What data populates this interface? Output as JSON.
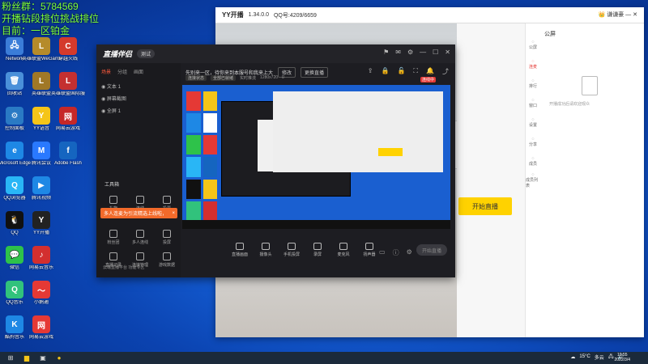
{
  "overlay": {
    "line1": "粉丝群：5784569",
    "line2": "开播钻段排位挑战排位",
    "line3": "目前：一区铂金",
    "right_tag": "5686"
  },
  "desktop_icons": [
    {
      "label": "Network",
      "color": "#3b7dd8",
      "glyph": "🖧"
    },
    {
      "label": "英雄联盟WeGame版",
      "color": "#b58b2a",
      "glyph": "L"
    },
    {
      "label": "穿越火线",
      "color": "#d43a2c",
      "glyph": "C"
    },
    {
      "label": "回收站",
      "color": "#4a90d9",
      "glyph": "🗑"
    },
    {
      "label": "英雄联盟",
      "color": "#a07826",
      "glyph": "L"
    },
    {
      "label": "英雄联盟国际服",
      "color": "#c43030",
      "glyph": "L"
    },
    {
      "label": "控制面板",
      "color": "#2a7ac4",
      "glyph": "⚙"
    },
    {
      "label": "YY语音",
      "color": "#f5c518",
      "glyph": "Y"
    },
    {
      "label": "网易云游戏",
      "color": "#c62828",
      "glyph": "网"
    },
    {
      "label": "Microsoft Edge",
      "color": "#1e88e5",
      "glyph": "e"
    },
    {
      "label": "腾讯会议",
      "color": "#2979ff",
      "glyph": "M"
    },
    {
      "label": "Adobe Flash",
      "color": "#1565c0",
      "glyph": "f"
    },
    {
      "label": "QQ浏览器",
      "color": "#29b6f6",
      "glyph": "Q"
    },
    {
      "label": "腾讯视频",
      "color": "#1e88e5",
      "glyph": "▶"
    },
    {
      "label": "",
      "color": "#0b43b0",
      "glyph": ""
    },
    {
      "label": "QQ",
      "color": "#111",
      "glyph": "🐧"
    },
    {
      "label": "YY开播",
      "color": "#222",
      "glyph": "Y"
    },
    {
      "label": "",
      "color": "#0b43b0",
      "glyph": ""
    },
    {
      "label": "微信",
      "color": "#2ec24a",
      "glyph": "💬"
    },
    {
      "label": "网易云音乐",
      "color": "#d32f2f",
      "glyph": "♪"
    },
    {
      "label": "",
      "color": "#0b43b0",
      "glyph": ""
    },
    {
      "label": "QQ音乐",
      "color": "#31c27c",
      "glyph": "Q"
    },
    {
      "label": "小鹅通",
      "color": "#e53935",
      "glyph": "〜"
    },
    {
      "label": "",
      "color": "#0b43b0",
      "glyph": ""
    },
    {
      "label": "酷狗音乐",
      "color": "#1e88e5",
      "glyph": "K"
    },
    {
      "label": "网易云游戏",
      "color": "#e53935",
      "glyph": "网"
    }
  ],
  "yy_window": {
    "logo": "YY开播",
    "version": "1.34.0.0",
    "qq_id": "QQ号:4209/6659",
    "user": "谦谦豪",
    "sidebar": [
      "公屏",
      "连麦",
      "排行",
      "窗口",
      "设置",
      "分享",
      "成员",
      "成员列表"
    ],
    "public_title": "公屏",
    "public_note": "开播成功后请欢迎观众",
    "start_button": "开始直播"
  },
  "zb_window": {
    "brand": "直播伴侣",
    "version_pill": "测试",
    "tabs": [
      "场景",
      "分组",
      "画面"
    ],
    "scenes": [
      "文本 1",
      "屏幕截图",
      "全屏 1"
    ],
    "tools_title": "工具箱",
    "tools": [
      "礼物",
      "连线",
      "投票",
      "粉丝团",
      "多人连线",
      "投屏",
      "直播记录",
      "连接管理",
      "游戏数据"
    ],
    "promo": "多人连麦为引流精选上线啦，",
    "promo_close": "×",
    "footer": "云端直播平台 功能专区",
    "topbar_text": "先别来一区，待你来到本服号和我来上大",
    "topbar_btn1": "修改",
    "topbar_btn2": "更换直播",
    "stats": [
      "连接状态",
      "全部已就绪",
      "实时推流",
      "1280x720",
      "0"
    ],
    "live_badge": "连线中",
    "bottom_buttons": [
      "直播画面",
      "摄像头",
      "手机投屏",
      "录屏",
      "麦克风",
      "扬声器"
    ],
    "start_live": "开始直播"
  },
  "taskbar": {
    "weather": "15°C",
    "weather_desc": "多云",
    "time": "10:55",
    "date": "2022/3/4"
  }
}
